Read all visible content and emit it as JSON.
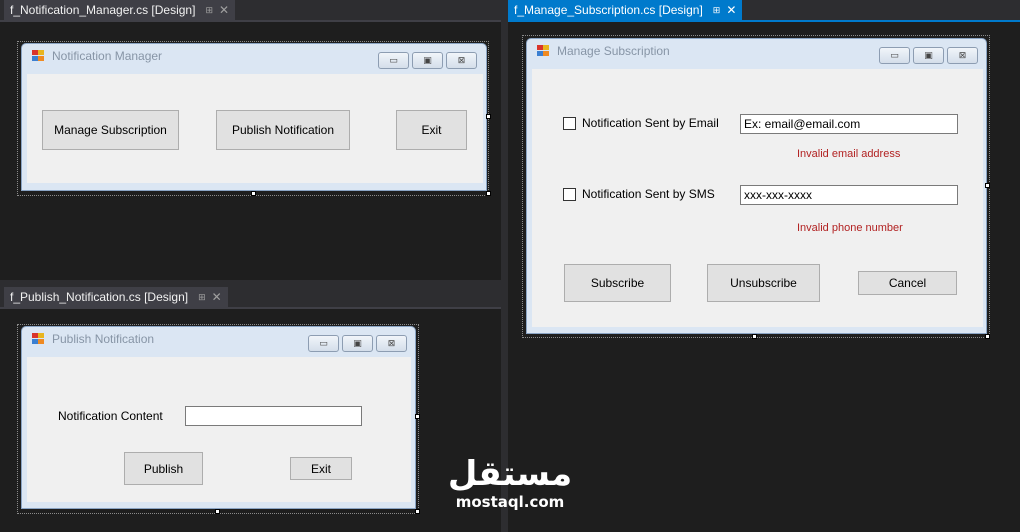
{
  "tabs": {
    "notification_manager": "f_Notification_Manager.cs [Design]",
    "publish_notification": "f_Publish_Notification.cs [Design]",
    "manage_subscription": "f_Manage_Subscription.cs [Design]",
    "pin_glyph": "⊞",
    "close_glyph": "✕"
  },
  "notification_manager": {
    "title": "Notification Manager",
    "manage_subscription_label": "Manage Subscription",
    "publish_notification_label": "Publish Notification",
    "exit_label": "Exit"
  },
  "publish_notification": {
    "title": "Publish Notification",
    "content_label": "Notification Content",
    "content_value": "",
    "publish_label": "Publish",
    "exit_label": "Exit"
  },
  "manage_subscription": {
    "title": "Manage Subscription",
    "email_checkbox_label": "Notification Sent by Email",
    "email_value": "Ex: email@email.com",
    "email_error": "Invalid email address",
    "sms_checkbox_label": "Notification Sent by SMS",
    "sms_value": "xxx-xxx-xxxx",
    "sms_error": "Invalid phone number",
    "subscribe_label": "Subscribe",
    "unsubscribe_label": "Unsubscribe",
    "cancel_label": "Cancel"
  },
  "caption_buttons": {
    "minimize": "▭",
    "maximize": "▣",
    "close": "⊠"
  },
  "watermark": {
    "arabic": "مستقل",
    "latin": "mostaql.com"
  },
  "colors": {
    "accent": "#007acc",
    "error": "#b22222",
    "background": "#1e1e1e"
  }
}
